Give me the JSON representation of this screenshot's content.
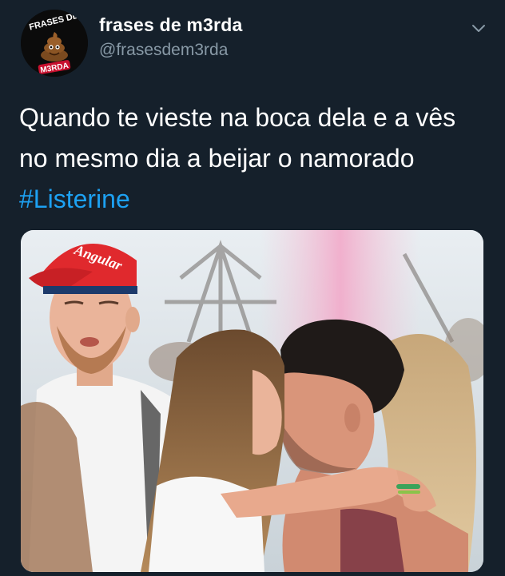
{
  "account": {
    "display_name": "frases de m3rda",
    "handle": "@frasesdem3rda",
    "avatar_text_top": "FRASES DE",
    "avatar_text_bottom": "M3RDA"
  },
  "tweet": {
    "lines": [
      "Quando te vieste na boca dela e a vês",
      "no mesmo dia a beijar o namorado"
    ],
    "hashtag": "#Listerine"
  },
  "photo": {
    "cap_text": "Angular"
  },
  "icons": {
    "more": "chevron-down-icon"
  },
  "colors": {
    "background": "#15202b",
    "text": "#ffffff",
    "secondary": "#8899a6",
    "link": "#1da1f2"
  }
}
